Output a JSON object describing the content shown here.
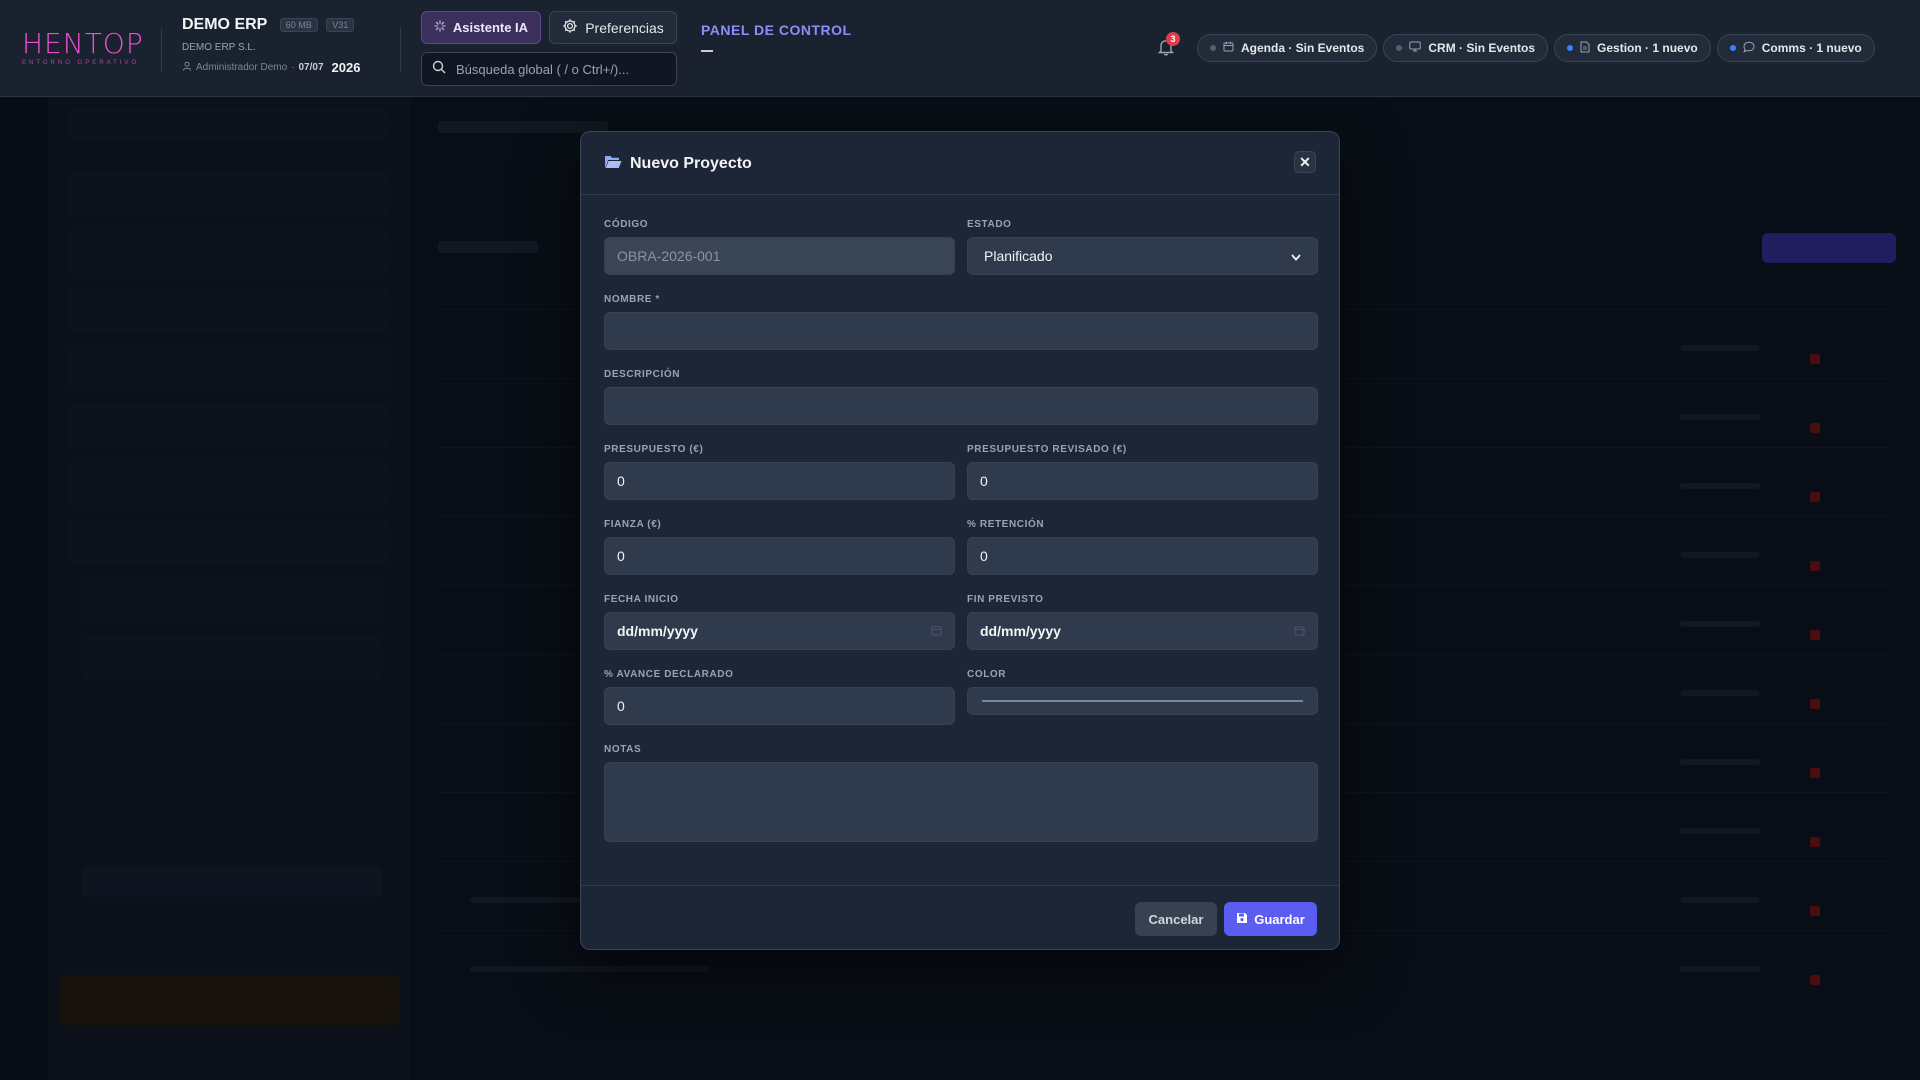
{
  "header": {
    "logo_text": "HENTOP",
    "logo_subtitle": "ENTORNO OPERATIVO",
    "company_name": "DEMO ERP",
    "size_badge": "60 MB",
    "version_badge": "V31",
    "company_legal": "DEMO ERP S.L.",
    "user": "Administrador Demo",
    "date": "07/07",
    "year": "2026",
    "ai_button": "Asistente IA",
    "prefs_button": "Preferencias",
    "search_placeholder": "Búsqueda global ( / o Ctrl+/)...",
    "panel_title": "PANEL DE CONTROL",
    "notification_count": "3",
    "chips": [
      {
        "label": "Agenda · Sin Eventos",
        "icon": "calendar-icon",
        "active": false
      },
      {
        "label": "CRM · Sin Eventos",
        "icon": "monitor-icon",
        "active": false
      },
      {
        "label": "Gestion · 1 nuevo",
        "icon": "document-icon",
        "active": true
      },
      {
        "label": "Comms · 1 nuevo",
        "icon": "chat-icon",
        "active": true
      }
    ]
  },
  "modal": {
    "title": "Nuevo Proyecto",
    "codigo_label": "CÓDIGO",
    "codigo_placeholder": "OBRA-2026-001",
    "estado_label": "ESTADO",
    "estado_value": "Planificado",
    "nombre_label": "NOMBRE *",
    "descripcion_label": "DESCRIPCIÓN",
    "presupuesto_label": "PRESUPUESTO (€)",
    "presupuesto_value": "0",
    "presupuesto_rev_label": "PRESUPUESTO REVISADO (€)",
    "presupuesto_rev_value": "0",
    "fianza_label": "FIANZA (€)",
    "fianza_value": "0",
    "retencion_label": "% RETENCIÓN",
    "retencion_value": "0",
    "fecha_inicio_label": "FECHA INICIO",
    "fecha_inicio_placeholder": "dd/mm/yyyy",
    "fin_previsto_label": "FIN PREVISTO",
    "fin_previsto_placeholder": "dd/mm/yyyy",
    "avance_label": "% AVANCE DECLARADO",
    "avance_value": "0",
    "color_label": "COLOR",
    "notas_label": "NOTAS",
    "cancel_button": "Cancelar",
    "save_button": "Guardar"
  },
  "colors": {
    "accent": "#5b5cf0",
    "logo": "#e94fd0",
    "badge": "#e23b4a",
    "panel_title": "#8b8ef7"
  }
}
